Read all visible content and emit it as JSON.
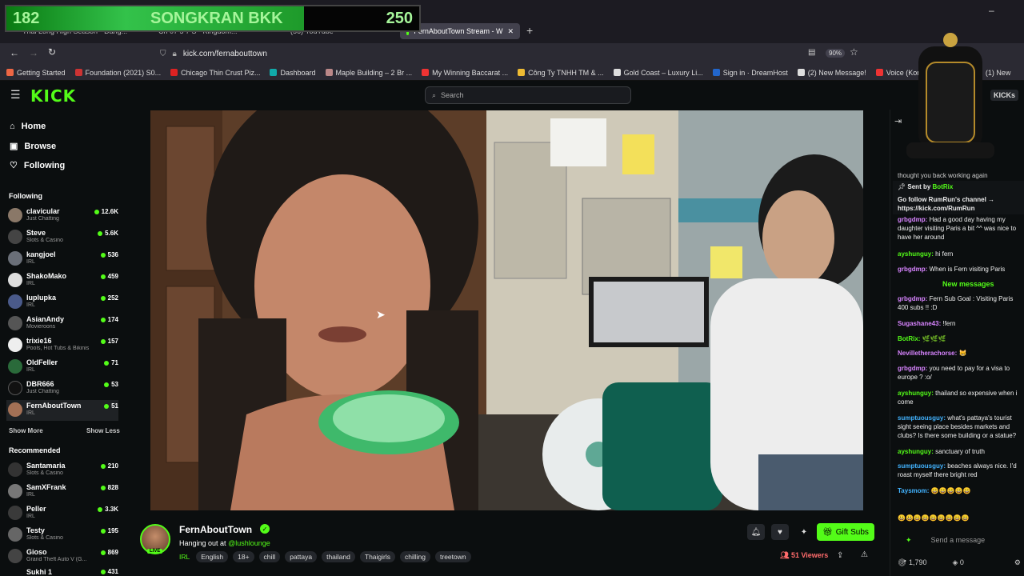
{
  "overlay": {
    "left_value": "182",
    "left_text": "SONGKRAN BKK",
    "right_value": "250"
  },
  "browser": {
    "tabs": [
      "Thai Long High Season - Dang...",
      "Ch 07 5 7 S - Kingdom...",
      "(56) YouTube",
      "FernAboutTown Stream - W"
    ],
    "url": "kick.com/fernabouttown",
    "zoom": "90%",
    "bookmarks": [
      "Getting Started",
      "Foundation (2021) S0...",
      "Chicago Thin Crust Piz...",
      "Dashboard",
      "Maple Building – 2 Br ...",
      "My Winning Baccarat ...",
      "Công Ty TNHH TM & ...",
      "Gold Coast – Luxury Li...",
      "Sign in · DreamHost",
      "(2) New Message!",
      "Voice (Korean Drama) ...",
      "(1) New"
    ]
  },
  "header": {
    "logo": "KICK",
    "search_placeholder": "Search",
    "kicks_label": "KICKs"
  },
  "nav": {
    "home": "Home",
    "browse": "Browse",
    "following": "Following"
  },
  "following": {
    "title": "Following",
    "channels": [
      {
        "name": "clavicular",
        "category": "Just Chatting",
        "viewers": "12.6K"
      },
      {
        "name": "Steve",
        "category": "Slots & Casino",
        "viewers": "5.6K"
      },
      {
        "name": "kangjoel",
        "category": "IRL",
        "viewers": "536"
      },
      {
        "name": "ShakoMako",
        "category": "IRL",
        "viewers": "459"
      },
      {
        "name": "luplupka",
        "category": "IRL",
        "viewers": "252"
      },
      {
        "name": "AsianAndy",
        "category": "Movieroons",
        "viewers": "174"
      },
      {
        "name": "trixie16",
        "category": "Pools, Hot Tubs & Bikinis",
        "viewers": "157"
      },
      {
        "name": "OldFeller",
        "category": "IRL",
        "viewers": "71"
      },
      {
        "name": "DBR666",
        "category": "Just Chatting",
        "viewers": "53"
      },
      {
        "name": "FernAboutTown",
        "category": "IRL",
        "viewers": "51"
      }
    ],
    "show_more": "Show More",
    "show_less": "Show Less"
  },
  "recommended": {
    "title": "Recommended",
    "channels": [
      {
        "name": "Santamaria",
        "category": "Slots & Casino",
        "viewers": "210"
      },
      {
        "name": "SamXFrank",
        "category": "IRL",
        "viewers": "828"
      },
      {
        "name": "Peller",
        "category": "IRL",
        "viewers": "3.3K"
      },
      {
        "name": "Testy",
        "category": "Slots & Casino",
        "viewers": "195"
      },
      {
        "name": "Gioso",
        "category": "Grand Theft Auto V (G...",
        "viewers": "869"
      },
      {
        "name": "Sukhi 1",
        "category": "",
        "viewers": "431"
      }
    ]
  },
  "stream": {
    "name": "FernAboutTown",
    "live": "LIVE",
    "title_prefix": "Hanging out at",
    "title_link": "@lushlounge",
    "category": "IRL",
    "tags": [
      "English",
      "18+",
      "chill",
      "pattaya",
      "thailand",
      "Thaigirls",
      "chilling",
      "treetown"
    ],
    "viewers": "51 Viewers",
    "gift_label": "Gift Subs"
  },
  "chat": {
    "top_frag": "thought you back working again",
    "pinned_label": "Sent by",
    "pinned_user": "BotRix",
    "pinned_text": "Go follow RumRun's channel → https://kick.com/RumRun",
    "messages": [
      {
        "user": "grbgdmp:",
        "text": "Had a good day having my daughter visiting Paris a bit ^^ was nice to have her around",
        "color": "p"
      },
      {
        "user": "ayshunguy:",
        "text": "hi fern",
        "color": "g"
      },
      {
        "user": "grbgdmp:",
        "text": "When is Fern visiting Paris",
        "color": "p"
      },
      {
        "user": "grbgdmp:",
        "text": "Fern Sub Goal : Visiting Paris 400 subs !! :D",
        "color": "p"
      },
      {
        "user": "Sugashane43:",
        "text": "!fern",
        "color": "p"
      },
      {
        "user": "BotRix:",
        "text": "🌿🌿🌿",
        "color": "g"
      },
      {
        "user": "Nevilletherachorse:",
        "text": "😸",
        "color": "p"
      },
      {
        "user": "grbgdmp:",
        "text": "you need to pay for a visa to europe ? :o/",
        "color": "p"
      },
      {
        "user": "ayshunguy:",
        "text": "thailand so expensive when i come",
        "color": "g"
      },
      {
        "user": "sumptuousguy:",
        "text": "what's pattaya's tourist sight seeing place besides markets and clubs? Is there some building or a statue?",
        "color": "b"
      },
      {
        "user": "ayshunguy:",
        "text": "sanctuary of truth",
        "color": "g"
      },
      {
        "user": "sumptuousguy:",
        "text": "beaches always nice. I'd roast myself there bright red",
        "color": "b"
      },
      {
        "user": "Taysmom:",
        "text": "😀😀😀😀😀",
        "color": "b"
      }
    ],
    "new_messages": "New messages",
    "input_placeholder": "Send a message",
    "points": "1,790",
    "zero": "0"
  }
}
